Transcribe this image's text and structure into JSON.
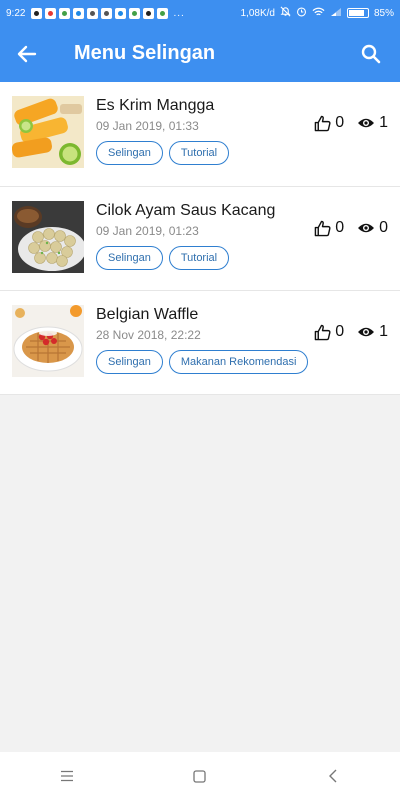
{
  "status_bar": {
    "time": "9:22",
    "dots": "...",
    "network_speed": "1,08K/d",
    "battery": "85%",
    "battery_level": 0.85
  },
  "app_bar": {
    "title": "Menu Selingan",
    "back_icon": "arrow-left-icon",
    "search_icon": "search-icon"
  },
  "items": [
    {
      "title": "Es Krim Mangga",
      "date": "09 Jan 2019, 01:33",
      "tags": [
        "Selingan",
        "Tutorial"
      ],
      "likes": "0",
      "views": "1"
    },
    {
      "title": "Cilok Ayam Saus Kacang",
      "date": "09 Jan 2019, 01:23",
      "tags": [
        "Selingan",
        "Tutorial"
      ],
      "likes": "0",
      "views": "0"
    },
    {
      "title": "Belgian Waffle",
      "date": "28 Nov 2018, 22:22",
      "tags": [
        "Selingan",
        "Makanan Rekomendasi"
      ],
      "likes": "0",
      "views": "1"
    }
  ],
  "nav_bar": {
    "menu_icon": "menu-lines-icon",
    "home_icon": "square-home-icon",
    "back_icon": "chevron-back-icon"
  },
  "colors": {
    "primary": "#3d8ff0",
    "tag_border": "#2f7fd0",
    "background": "#f2f2f2"
  }
}
